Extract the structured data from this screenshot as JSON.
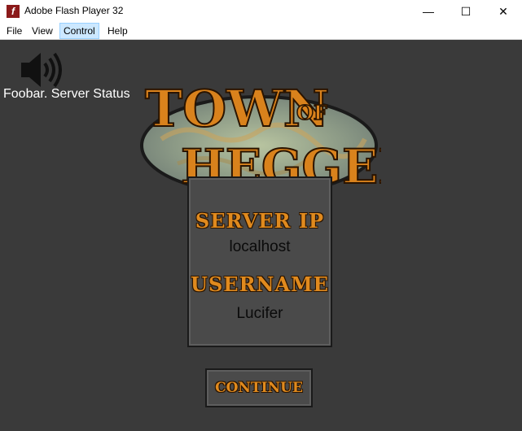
{
  "window": {
    "title": "Adobe Flash Player 32",
    "minimize": "—",
    "maximize": "☐",
    "close": "✕",
    "app_icon_glyph": "f"
  },
  "menu": {
    "items": [
      {
        "label": "File"
      },
      {
        "label": "View"
      },
      {
        "label": "Control",
        "active": true
      },
      {
        "label": "Help"
      }
    ]
  },
  "game": {
    "server_status": "Foobar. Server Status",
    "logo": {
      "line1": "TOWN",
      "of": "OF",
      "line2": "HEGGEN"
    },
    "server_ip_label": "SERVER IP",
    "server_ip_value": "localhost",
    "username_label": "USERNAME",
    "username_value": "Lucifer",
    "continue_label": "CONTINUE"
  },
  "colors": {
    "background": "#3a3a3a",
    "accent_orange": "#e08a1e",
    "panel": "#4a4a4a"
  },
  "icons": [
    "flash-icon",
    "speaker-icon"
  ]
}
